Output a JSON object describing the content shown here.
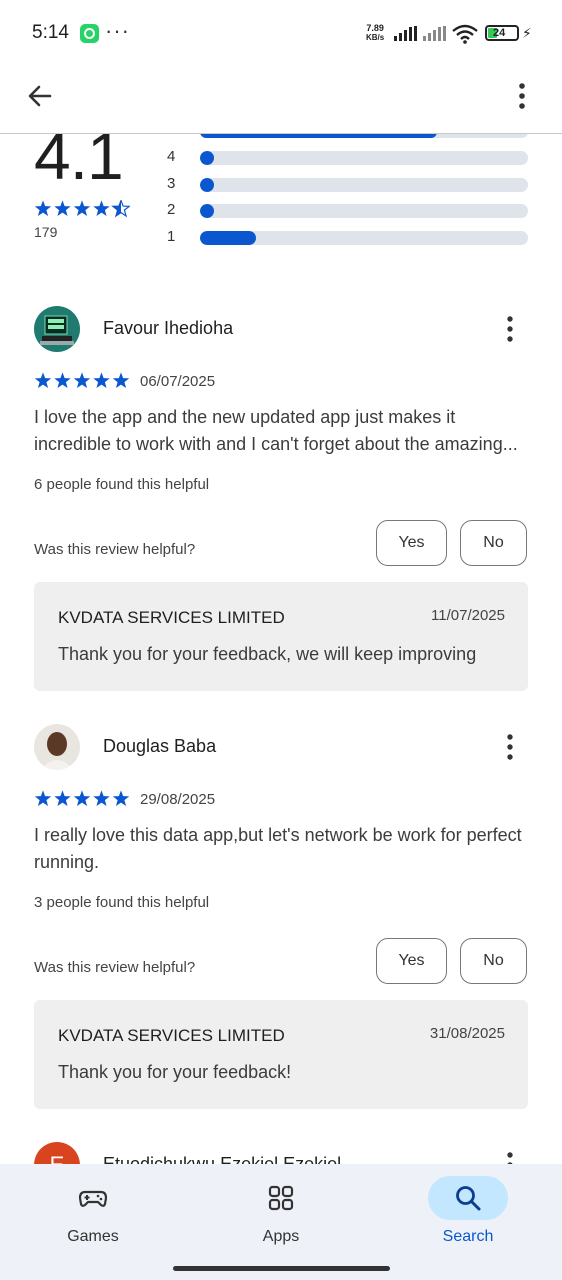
{
  "status_bar": {
    "time": "5:14",
    "dots": "···",
    "net_speed_value": "7.89",
    "net_speed_unit": "KB/s",
    "battery": "24"
  },
  "rating_summary": {
    "average": "4.1",
    "stars": 4.5,
    "review_count": "179",
    "bars": [
      {
        "label": "4",
        "fraction": 0.03
      },
      {
        "label": "3",
        "fraction": 0.03
      },
      {
        "label": "2",
        "fraction": 0.03
      },
      {
        "label": "1",
        "fraction": 0.17
      }
    ]
  },
  "reviews": [
    {
      "name": "Favour Ihedioha",
      "stars": 5,
      "date": "06/07/2025",
      "text": "I love the app and the new updated app just makes it incredible to work with and I can't forget about the amazing...",
      "helpful_count": "6 people found this helpful",
      "helpful_question": "Was this review helpful?",
      "yes_label": "Yes",
      "no_label": "No",
      "reply": {
        "developer": "KVDATA SERVICES LIMITED",
        "date": "11/07/2025",
        "text": "Thank you for your feedback, we will keep improving"
      }
    },
    {
      "name": "Douglas Baba",
      "stars": 5,
      "date": "29/08/2025",
      "text": "I really love this data app,but let's network be work for perfect running.",
      "helpful_count": "3 people found this helpful",
      "helpful_question": "Was this review helpful?",
      "yes_label": "Yes",
      "no_label": "No",
      "reply": {
        "developer": "KVDATA SERVICES LIMITED",
        "date": "31/08/2025",
        "text": "Thank you for your feedback!"
      }
    }
  ],
  "next_review": {
    "initial": "E",
    "name": "Etuodichukwu Ezekiel Ezekiel"
  },
  "bottom_nav": [
    {
      "label": "Games",
      "icon": "gamepad-icon",
      "active": false
    },
    {
      "label": "Apps",
      "icon": "apps-grid-icon",
      "active": false
    },
    {
      "label": "Search",
      "icon": "search-icon",
      "active": true
    }
  ],
  "colors": {
    "accent": "#0b57d0",
    "bar_track": "#dfe3ea",
    "active_pill": "#c2e7ff",
    "nav_bg": "#eef2f8"
  }
}
